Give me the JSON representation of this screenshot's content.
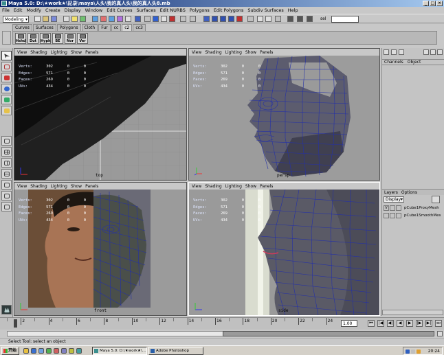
{
  "window": {
    "title": "Maya 5.0: D:\\★work★\\記录\\maya\\人头\\我的真人头\\我的真人头8.mb"
  },
  "menubar": [
    "File",
    "Edit",
    "Modify",
    "Create",
    "Display",
    "Window",
    "Edit Curves",
    "Surfaces",
    "Edit NURBS",
    "Polygons",
    "Edit Polygons",
    "Subdiv Surfaces",
    "Help"
  ],
  "statusline": {
    "mode": "Modeling",
    "selection_label": "sel"
  },
  "shelf": {
    "tabs": [
      "Curves",
      "Surfaces",
      "Polygons",
      "Cloth",
      "Fur",
      "cc",
      "c2",
      "cc3"
    ],
    "active_tab": "c2",
    "buttons": [
      "Hshd",
      "Dut",
      "Hyph",
      "BE",
      "Nor",
      "Ver"
    ]
  },
  "hud": {
    "rows": [
      {
        "key": "Verts:",
        "value": "302",
        "sel": "0",
        "extra": "0"
      },
      {
        "key": "Edges:",
        "value": "571",
        "sel": "0",
        "extra": "0"
      },
      {
        "key": "Faces:",
        "value": "269",
        "sel": "0",
        "extra": "0"
      },
      {
        "key": "UVs:",
        "value": "434",
        "sel": "0",
        "extra": "0"
      }
    ]
  },
  "panel_menu": [
    "View",
    "Shading",
    "Lighting",
    "Show",
    "Panels"
  ],
  "viewports": [
    {
      "camera": "top"
    },
    {
      "camera": "persp"
    },
    {
      "camera": "front"
    },
    {
      "camera": "side"
    }
  ],
  "channel_box": {
    "tabs": [
      "Channels",
      "Object"
    ]
  },
  "layers": {
    "tabs": [
      "Layers",
      "Options"
    ],
    "display_label": "Display",
    "items": [
      {
        "visible": "V",
        "name": "pCube1ProxyMesh"
      },
      {
        "visible": "",
        "name": "pCube1SmoothMes"
      }
    ]
  },
  "timeslider": {
    "tick_labels": [
      "2",
      "4",
      "6",
      "8",
      "10",
      "12",
      "14",
      "16",
      "18",
      "20",
      "22",
      "24"
    ],
    "current_time": "1.00",
    "playback_buttons": [
      "|◀◀",
      "|◀",
      "◀|",
      "◀",
      "▶",
      "|▶",
      "▶|",
      "▶▶|"
    ]
  },
  "helpline": {
    "text": "Select Tool: select an object"
  },
  "taskbar": {
    "start_label": "开始",
    "tasks": [
      {
        "label": "Maya 5.0: D:\\★work★\\...",
        "pressed": true
      },
      {
        "label": "Adobe Photoshop",
        "pressed": false
      }
    ],
    "clock": "20:24"
  },
  "colors": {
    "accent_title": "#0a246a",
    "viewport_bg": "#9b9b9b",
    "wire_blue": "#2430a8"
  }
}
